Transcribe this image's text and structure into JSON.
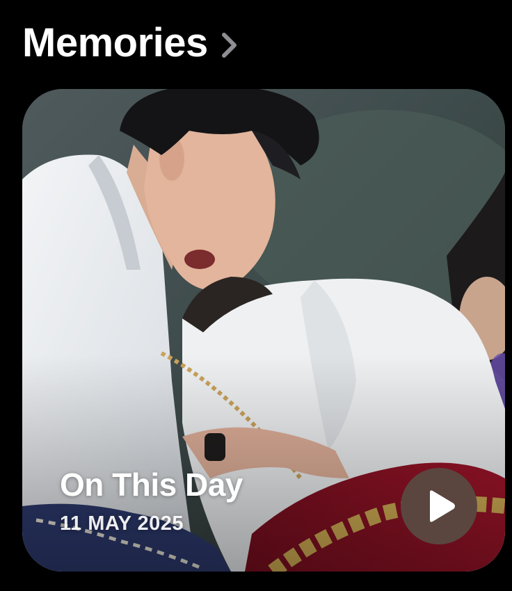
{
  "header": {
    "title": "Memories",
    "chevron_icon": "chevron-right-icon"
  },
  "memory_card": {
    "title": "On This Day",
    "date": "11 MAY 2025",
    "play_icon": "play-icon",
    "play_button_color": "#5a463f"
  }
}
